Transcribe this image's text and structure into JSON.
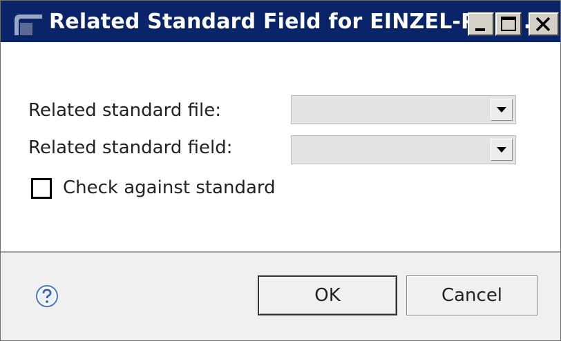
{
  "window": {
    "title": "Related Standard Field for EINZEL-PE (...",
    "titlebar_color": "#0a246a"
  },
  "form": {
    "file_label": "Related standard file:",
    "file_value": "",
    "field_label": "Related standard field:",
    "field_value": "",
    "check_label": "Check against standard",
    "check_checked": false
  },
  "buttons": {
    "ok": "OK",
    "cancel": "Cancel"
  },
  "icons": {
    "app": "app-icon",
    "minimize": "minimize-icon",
    "maximize": "maximize-icon",
    "close": "close-icon",
    "help": "help-icon",
    "dropdown": "chevron-down-icon"
  }
}
